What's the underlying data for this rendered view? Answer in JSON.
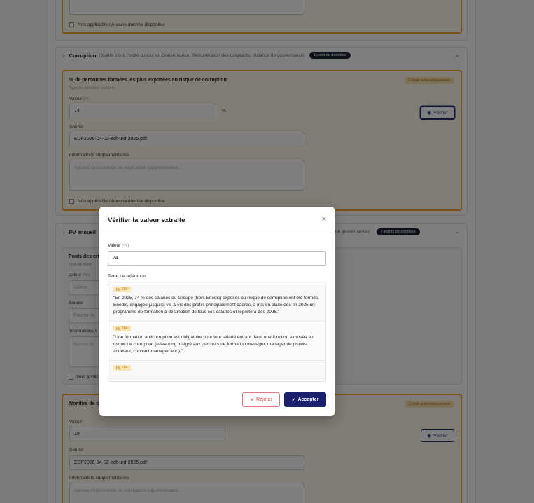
{
  "background": {
    "top_card": {
      "checkbox_label": "Non applicable / Aucune donnée disponible"
    },
    "corruption_section": {
      "title": "Corruption",
      "subtitle": "(Sujets mis à l'ordre du jour en Gouvernance, Rémunération des dirigeants, Instance de gouvernance)",
      "badge": "1 point de données",
      "card": {
        "title": "% de personnes formées les plus exposées au risque de corruption",
        "type": "Type de données: numeric",
        "auto_badge": "Extrait automatiquement",
        "value_label": "Valeur",
        "value_unit": "(%)",
        "value": "74",
        "unit_suffix": "%",
        "verify": "Vérifier",
        "source_label": "Source",
        "source_value": "EDF2026-04-02-edf-urd-2025.pdf",
        "info_label": "Informations supplémentaires",
        "info_placeholder": "Ajoutez tout contexte ou explication supplémentaire...",
        "checkbox_label": "Non applicable / Aucune donnée disponible"
      }
    },
    "pv_section": {
      "title": "PV annuell",
      "subtitle_tail": "ue gouvernance)",
      "badge": "7 points de données",
      "card": {
        "title": "Poids des crit",
        "type": "Type de donn",
        "value_label": "Valeur",
        "value_unit": "(%)",
        "value_placeholder": "Valeur",
        "source_label": "Source",
        "source_placeholder": "Fournir la",
        "info_label": "Informations s",
        "info_placeholder": "Ajoutez to",
        "checkbox_label": "Non applic"
      },
      "card2": {
        "title": "Nombre de cr",
        "auto_badge": "Extrait automatiquement",
        "value_label": "Valeur",
        "value": "19",
        "verify": "Vérifier",
        "source_label": "Source",
        "source_value": "EDF2026-04-02-edf-urd-2025.pdf",
        "info_label": "Informations supplémentaires",
        "info_placeholder": "Ajoutez tout contexte ou explication supplémentaire..."
      }
    }
  },
  "modal": {
    "title": "Vérifier la valeur extraite",
    "close": "×",
    "value_label": "Valeur",
    "value_unit": "(%)",
    "value": "74",
    "ref_label": "Texte de référence",
    "references": [
      {
        "page": "pg 264",
        "text": "\"En 2025, 74 % des salariés du Groupe (hors Enedis) exposés au risque de corruption ont été formés. Enedis, engagée jusqu'ici vis-à-vis des profils principalement cadres, a mis en place dès fin 2025 un programme de formation à destination de tous ses salariés et reportera dès 2026.\""
      },
      {
        "page": "pg 264",
        "text": "\"Une formation anticorruption est obligatoire pour tout salarié entrant dans une fonction exposée au risque de corruption (e-learning intégré aux parcours de formation manager, manager de projets, acheteur, contract manager, etc.).\""
      },
      {
        "page": "pg 264",
        "text": ""
      }
    ],
    "reject": "Rejeter",
    "accept": "Accepter"
  }
}
